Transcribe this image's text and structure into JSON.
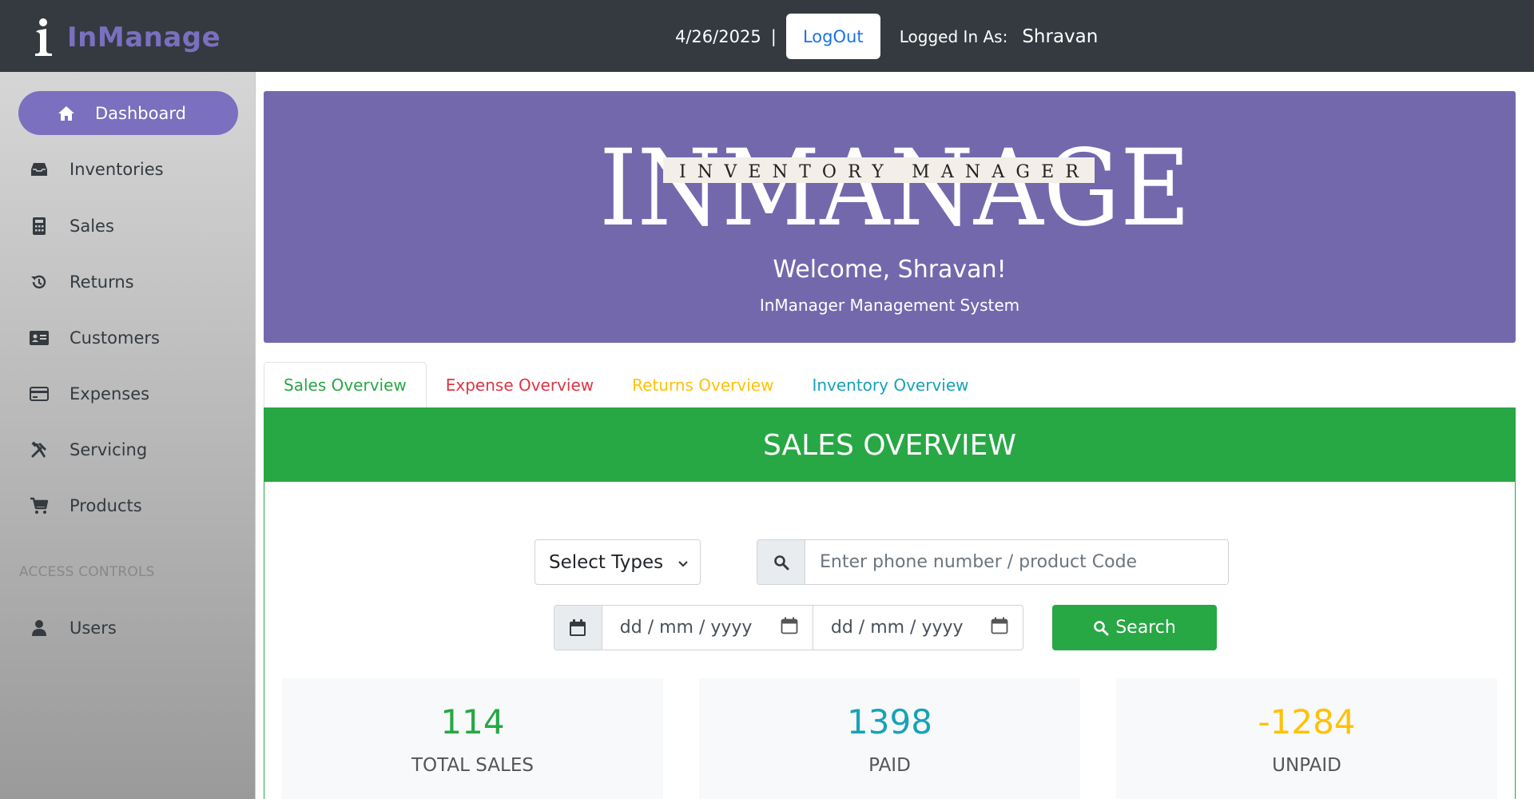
{
  "colors": {
    "topbar": "#343a40",
    "brand": "#7b6fbf",
    "hero": "#7468ad",
    "success": "#28a745",
    "danger": "#dc3545",
    "warning": "#ffc107",
    "info": "#17a2b8",
    "link": "#1a73e8"
  },
  "header": {
    "brand_name": "InManage",
    "brand_logo_icon": "info-person-logo",
    "date": "4/26/2025",
    "separator": "|",
    "logout_label": "LogOut",
    "logged_in_label": "Logged In As:",
    "username": "Shravan"
  },
  "sidebar": {
    "items": [
      {
        "label": "Dashboard",
        "icon": "home-icon",
        "active": true
      },
      {
        "label": "Inventories",
        "icon": "inbox-icon"
      },
      {
        "label": "Sales",
        "icon": "calculator-icon"
      },
      {
        "label": "Returns",
        "icon": "history-icon"
      },
      {
        "label": "Customers",
        "icon": "id-card-icon"
      },
      {
        "label": "Expenses",
        "icon": "credit-card-icon"
      },
      {
        "label": "Servicing",
        "icon": "tools-icon"
      },
      {
        "label": "Products",
        "icon": "cart-icon"
      }
    ],
    "section_label": "ACCESS CONTROLS",
    "access_items": [
      {
        "label": "Users",
        "icon": "user-icon"
      }
    ]
  },
  "hero": {
    "logo_title": "INMANAGE",
    "logo_subtitle": "INVENTORY MANAGER",
    "welcome": "Welcome, Shravan!",
    "subtitle": "InManager Management System"
  },
  "tabs": [
    {
      "label": "Sales Overview",
      "active": true,
      "color": "#28a745"
    },
    {
      "label": "Expense Overview",
      "color": "#dc3545"
    },
    {
      "label": "Returns Overview",
      "color": "#ffc107"
    },
    {
      "label": "Inventory Overview",
      "color": "#17a2b8"
    }
  ],
  "sales_overview": {
    "title": "SALES OVERVIEW",
    "type_select": {
      "value": "Select Types"
    },
    "search": {
      "placeholder": "Enter phone number / product Code"
    },
    "date_from": "dd / mm / yyyy",
    "date_to": "dd / mm / yyyy",
    "search_button": "Search",
    "stats": [
      {
        "value": "114",
        "label": "TOTAL SALES",
        "color": "#28a745"
      },
      {
        "value": "1398",
        "label": "PAID",
        "color": "#17a2b8"
      },
      {
        "value": "-1284",
        "label": "UNPAID",
        "color": "#ffc107"
      }
    ]
  }
}
